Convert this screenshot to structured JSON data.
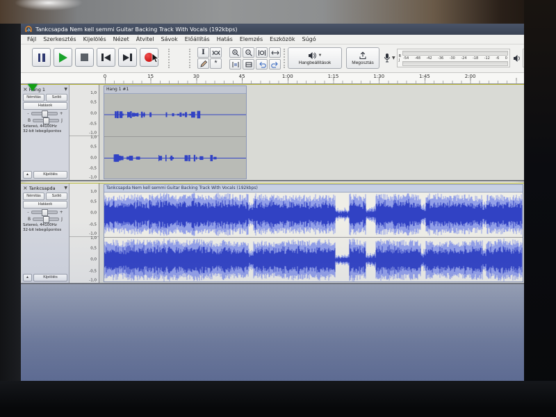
{
  "window": {
    "title": "Tankcsapda Nem kell semmi Guitar Backing Track With Vocals (192kbps)"
  },
  "menu": {
    "items": [
      "Fájl",
      "Szerkesztés",
      "Kijelölés",
      "Nézet",
      "Átvitel",
      "Sávok",
      "Előállítás",
      "Hatás",
      "Elemzés",
      "Eszközök",
      "Súgó"
    ]
  },
  "toolbar": {
    "audio_settings_label": "Hangbeállítások",
    "share_label": "Megosztás",
    "meter_db_scale": [
      "-54",
      "-48",
      "-42",
      "-36",
      "-30",
      "-24",
      "-18",
      "-12",
      "-6",
      "0"
    ],
    "meter_channel_left": "B",
    "meter_channel_right": "J"
  },
  "timeline": {
    "ticks": [
      "0",
      "15",
      "30",
      "45",
      "1:00",
      "1:15",
      "1:30",
      "1:45",
      "2:00"
    ]
  },
  "track_labels": {
    "mute": "Némítás",
    "solo": "Szóló",
    "effects": "Hatások",
    "select": "Kijelölés",
    "info1": "Sztereó, 44100Hz",
    "info2": "32-bit lebegőpontos",
    "gain_minus": "-",
    "gain_plus": "+",
    "pan_left": "B",
    "pan_right": "J"
  },
  "scale_labels": [
    "1,0",
    "0,5",
    "0,0",
    "-0,5",
    "-1,0"
  ],
  "tracks": [
    {
      "name": "Hang 1",
      "clip_title": "Hang 1 #1"
    },
    {
      "name": "Tankcsapda",
      "clip_title": "Tankcsapda Nem kell semmi Guitar Backing Track With Vocals (192kbps)"
    }
  ],
  "colors": {
    "titlebar": "#3e4756",
    "play_green": "#18a32b",
    "record_red": "#cf1b1b",
    "waveform_dark": "#3142c4",
    "waveform_light": "#93a0e8",
    "playhead_green": "#12a012"
  }
}
